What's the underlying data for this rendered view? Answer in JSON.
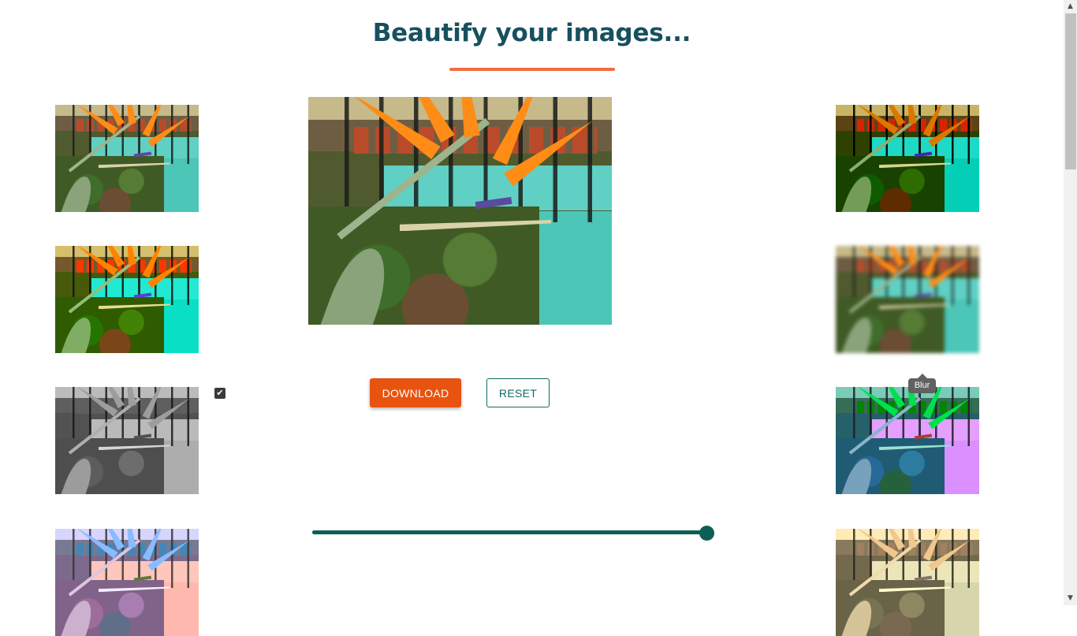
{
  "header": {
    "title": "Beautify your images..."
  },
  "colors": {
    "title": "#17505f",
    "accent_underline": "#f26e3f",
    "download_button": "#e8530f",
    "reset_border": "#0f6b63",
    "slider": "#0b5f57"
  },
  "filters_left": [
    {
      "name": "original"
    },
    {
      "name": "saturate"
    },
    {
      "name": "grayscale"
    },
    {
      "name": "invert"
    }
  ],
  "filters_right": [
    {
      "name": "contrast"
    },
    {
      "name": "blur"
    },
    {
      "name": "hue-rotate"
    },
    {
      "name": "sepia"
    }
  ],
  "checkbox": {
    "checked": true,
    "glyph": "✔"
  },
  "actions": {
    "download_label": "DOWNLOAD",
    "reset_label": "RESET"
  },
  "tooltip": {
    "text": "Blur"
  },
  "slider": {
    "value_fraction": 1.0
  },
  "scrollbar": {
    "up_glyph": "▲",
    "down_glyph": "▼"
  }
}
